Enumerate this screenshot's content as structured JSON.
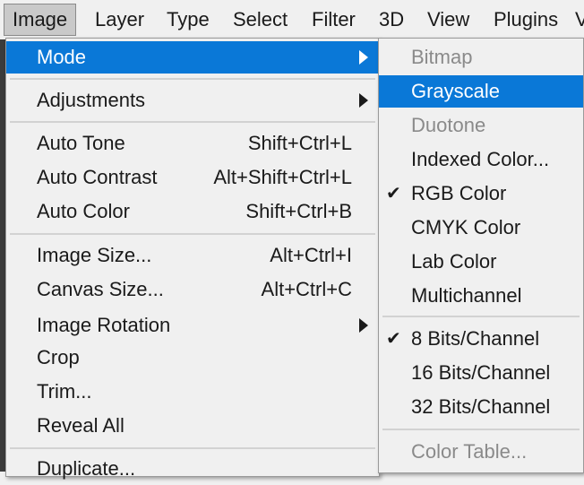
{
  "menubar": {
    "items": [
      "Image",
      "Layer",
      "Type",
      "Select",
      "Filter",
      "3D",
      "View",
      "Plugins",
      "V"
    ]
  },
  "image_menu": {
    "mode": "Mode",
    "adjustments": "Adjustments",
    "auto_tone": "Auto Tone",
    "auto_tone_shortcut": "Shift+Ctrl+L",
    "auto_contrast": "Auto Contrast",
    "auto_contrast_shortcut": "Alt+Shift+Ctrl+L",
    "auto_color": "Auto Color",
    "auto_color_shortcut": "Shift+Ctrl+B",
    "image_size": "Image Size...",
    "image_size_shortcut": "Alt+Ctrl+I",
    "canvas_size": "Canvas Size...",
    "canvas_size_shortcut": "Alt+Ctrl+C",
    "image_rotation": "Image Rotation",
    "crop": "Crop",
    "trim": "Trim...",
    "reveal_all": "Reveal All",
    "duplicate": "Duplicate..."
  },
  "mode_submenu": {
    "bitmap": "Bitmap",
    "grayscale": "Grayscale",
    "duotone": "Duotone",
    "indexed_color": "Indexed Color...",
    "rgb_color": "RGB Color",
    "cmyk_color": "CMYK Color",
    "lab_color": "Lab Color",
    "multichannel": "Multichannel",
    "bits_8": "8 Bits/Channel",
    "bits_16": "16 Bits/Channel",
    "bits_32": "32 Bits/Channel",
    "color_table": "Color Table...",
    "check_mark": "✔"
  },
  "colors": {
    "highlight": "#0a78d7",
    "menu_bg": "#f0f0f0",
    "disabled_text": "#8a8a8a"
  }
}
